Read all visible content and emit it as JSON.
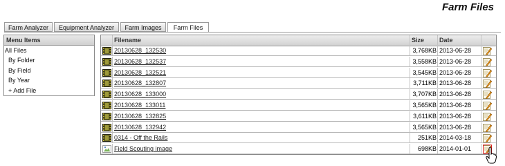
{
  "page": {
    "title": "Farm Files"
  },
  "tabs": [
    {
      "label": "Farm Analyzer"
    },
    {
      "label": "Equipment Analyzer"
    },
    {
      "label": "Farm Images"
    },
    {
      "label": "Farm Files",
      "active": true
    }
  ],
  "menu": {
    "header": "Menu Items",
    "items": [
      {
        "label": "All Files"
      },
      {
        "label": "By Folder"
      },
      {
        "label": "By Field"
      },
      {
        "label": "By Year"
      },
      {
        "label": "+ Add File"
      }
    ]
  },
  "grid": {
    "columns": {
      "filename": "Filename",
      "size": "Size",
      "date": "Date"
    },
    "rows": [
      {
        "filename": "20130628_132530",
        "size": "3,768KB",
        "date": "2013-06-28",
        "icon": "film-icon"
      },
      {
        "filename": "20130628_132537",
        "size": "3,558KB",
        "date": "2013-06-28",
        "icon": "film-icon"
      },
      {
        "filename": "20130628_132521",
        "size": "3,545KB",
        "date": "2013-06-28",
        "icon": "film-icon"
      },
      {
        "filename": "20130628_132807",
        "size": "3,711KB",
        "date": "2013-06-28",
        "icon": "film-icon"
      },
      {
        "filename": "20130628_133000",
        "size": "3,707KB",
        "date": "2013-06-28",
        "icon": "film-icon"
      },
      {
        "filename": "20130628_133011",
        "size": "3,565KB",
        "date": "2013-06-28",
        "icon": "film-icon"
      },
      {
        "filename": "20130628_132825",
        "size": "3,611KB",
        "date": "2013-06-28",
        "icon": "film-icon"
      },
      {
        "filename": "20130628_132942",
        "size": "3,565KB",
        "date": "2013-06-28",
        "icon": "film-icon"
      },
      {
        "filename": "0314 - Off the Rails",
        "size": "251KB",
        "date": "2014-03-18",
        "icon": "film-icon"
      },
      {
        "filename": "Field Scouting image",
        "size": "698KB",
        "date": "2014-01-01",
        "icon": "image-icon"
      }
    ]
  },
  "colors": {
    "highlight": "#e02020",
    "border": "#8a8a8a"
  }
}
